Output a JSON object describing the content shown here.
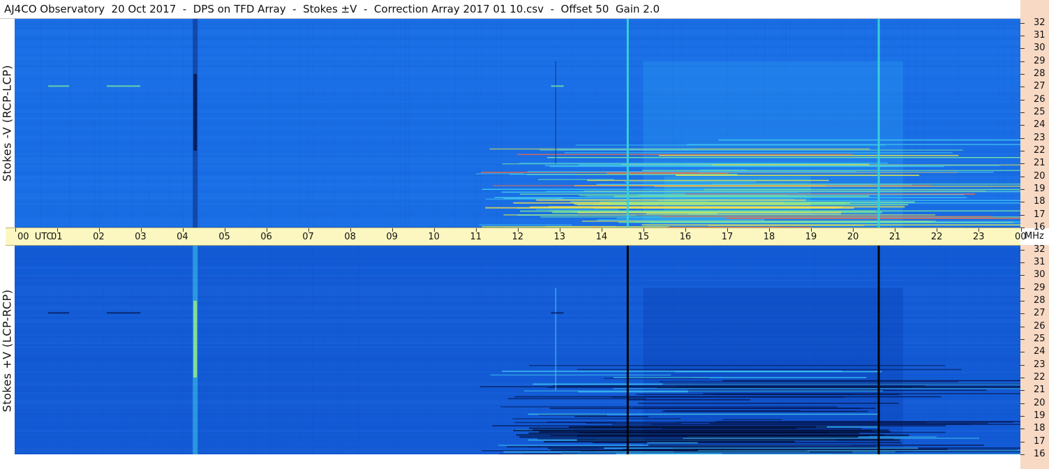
{
  "header": {
    "title": "AJ4CO Observatory  20 Oct 2017  -  DPS on TFD Array  -  Stokes ±V  -  Correction Array 2017 01 10.csv  -  Offset 50  Gain 2.0"
  },
  "panels": {
    "top_label": "Stokes -V (RCP-LCP)",
    "bottom_label": "Stokes +V (LCP-RCP)"
  },
  "time_axis": {
    "labels": [
      "00  UTC",
      "01",
      "02",
      "03",
      "04",
      "05",
      "06",
      "07",
      "08",
      "09",
      "10",
      "11",
      "12",
      "13",
      "14",
      "15",
      "16",
      "17",
      "18",
      "19",
      "20",
      "21",
      "22",
      "23",
      "00"
    ],
    "unit": "MHz"
  },
  "freq_axis": {
    "labels": [
      "32",
      "31",
      "30",
      "29",
      "28",
      "27",
      "26",
      "25",
      "24",
      "23",
      "22",
      "21",
      "20",
      "19",
      "18",
      "17",
      "16"
    ]
  },
  "colors": {
    "background_top": "#1a6fe6",
    "background_bottom": "#135bd6",
    "time_axis_bg": "#fcf7c0",
    "freq_axis_bg": "#f7d9c4"
  },
  "chart_data": {
    "type": "heatmap",
    "title": "AJ4CO Observatory  20 Oct 2017  -  DPS on TFD Array  -  Stokes ±V  -  Correction Array 2017 01 10.csv  -  Offset 50  Gain 2.0",
    "xlabel": "UTC",
    "ylabel_top": "Stokes -V (RCP-LCP)",
    "ylabel_bottom": "Stokes +V (LCP-RCP)",
    "x_range": [
      0,
      24
    ],
    "y_range": [
      16,
      32.3
    ],
    "y_unit": "MHz",
    "x_ticks": [
      0,
      1,
      2,
      3,
      4,
      5,
      6,
      7,
      8,
      9,
      10,
      11,
      12,
      13,
      14,
      15,
      16,
      17,
      18,
      19,
      20,
      21,
      22,
      23,
      24
    ],
    "y_ticks": [
      32,
      31,
      30,
      29,
      28,
      27,
      26,
      25,
      24,
      23,
      22,
      21,
      20,
      19,
      18,
      17,
      16
    ],
    "features": {
      "dark_column_top_utc": 4.3,
      "bright_column_bottom_utc": 4.3,
      "vertical_lines_utc": [
        14.63,
        20.62
      ],
      "interference_onset_utc": 11.0,
      "enhanced_block_utc": [
        15.0,
        21.2
      ],
      "strong_band_mhz": [
        17.0,
        18.5
      ]
    }
  }
}
